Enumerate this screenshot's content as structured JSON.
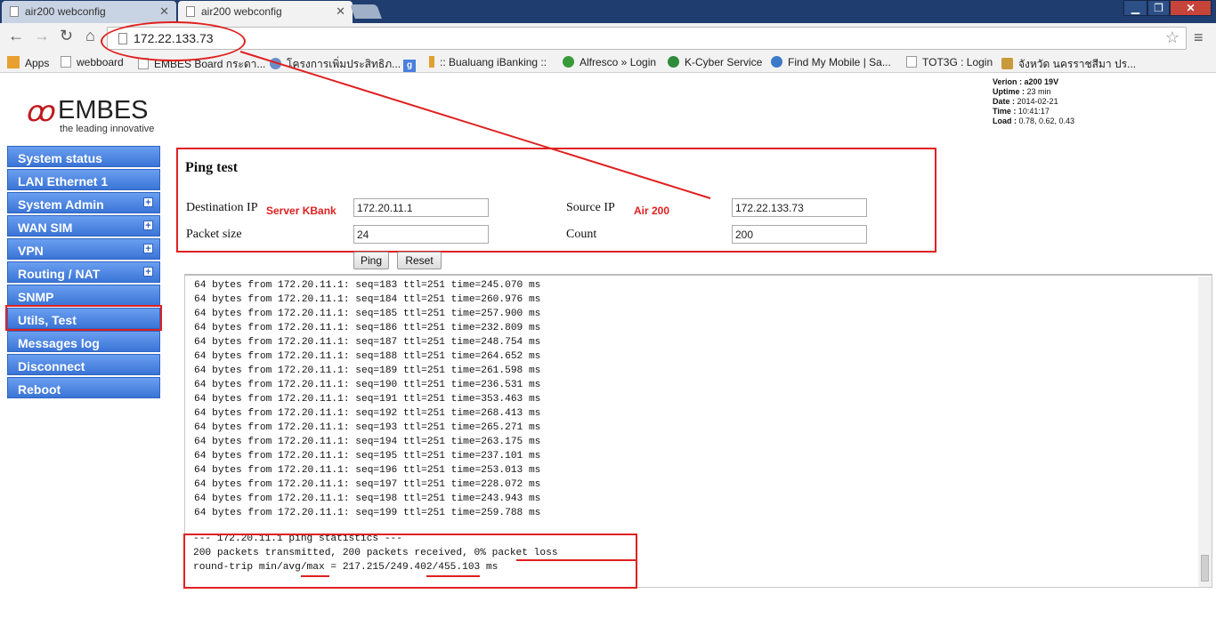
{
  "browser": {
    "tabs": [
      {
        "label": "air200 webconfig"
      },
      {
        "label": "air200 webconfig"
      }
    ],
    "url": "172.22.133.73",
    "bookmarks": [
      "Apps",
      "webboard",
      "EMBES Board กระดา...",
      "โครงการเพิ่มประสิทธิภ...",
      "g",
      ":: Bualuang iBanking ::",
      "Alfresco » Login",
      "K-Cyber Service",
      "Find My Mobile | Sa...",
      "TOT3G : Login",
      "จังหวัด นครราชสีมา ปร..."
    ]
  },
  "logo": {
    "name": "EMBES",
    "tagline": "the leading innovative"
  },
  "sysinfo": {
    "version_label": "Verion :",
    "version": "a200 19V",
    "uptime_label": "Uptime :",
    "uptime": "23 min",
    "date_label": "Date :",
    "date": "2014-02-21",
    "time_label": "Time :",
    "time": "10:41:17",
    "load_label": "Load :",
    "load": "0.78, 0.62, 0.43"
  },
  "sidebar": {
    "items": [
      {
        "label": "System status"
      },
      {
        "label": "LAN Ethernet 1"
      },
      {
        "label": "System Admin",
        "expand": "+"
      },
      {
        "label": "WAN SIM",
        "expand": "+"
      },
      {
        "label": "VPN",
        "expand": "+"
      },
      {
        "label": "Routing / NAT",
        "expand": "+"
      },
      {
        "label": "SNMP"
      },
      {
        "label": "Utils, Test"
      },
      {
        "label": "Messages log"
      },
      {
        "label": "Disconnect"
      },
      {
        "label": "Reboot"
      }
    ]
  },
  "ping": {
    "title": "Ping test",
    "dest_label": "Destination IP",
    "dest_note": "Server KBank",
    "dest_value": "172.20.11.1",
    "src_label": "Source IP",
    "src_note": "Air 200",
    "src_value": "172.22.133.73",
    "size_label": "Packet size",
    "size_value": "24",
    "count_label": "Count",
    "count_value": "200",
    "ping_button": "Ping",
    "reset_button": "Reset"
  },
  "output": {
    "lines": "64 bytes from 172.20.11.1: seq=183 ttl=251 time=245.070 ms\n64 bytes from 172.20.11.1: seq=184 ttl=251 time=260.976 ms\n64 bytes from 172.20.11.1: seq=185 ttl=251 time=257.900 ms\n64 bytes from 172.20.11.1: seq=186 ttl=251 time=232.809 ms\n64 bytes from 172.20.11.1: seq=187 ttl=251 time=248.754 ms\n64 bytes from 172.20.11.1: seq=188 ttl=251 time=264.652 ms\n64 bytes from 172.20.11.1: seq=189 ttl=251 time=261.598 ms\n64 bytes from 172.20.11.1: seq=190 ttl=251 time=236.531 ms\n64 bytes from 172.20.11.1: seq=191 ttl=251 time=353.463 ms\n64 bytes from 172.20.11.1: seq=192 ttl=251 time=268.413 ms\n64 bytes from 172.20.11.1: seq=193 ttl=251 time=265.271 ms\n64 bytes from 172.20.11.1: seq=194 ttl=251 time=263.175 ms\n64 bytes from 172.20.11.1: seq=195 ttl=251 time=237.101 ms\n64 bytes from 172.20.11.1: seq=196 ttl=251 time=253.013 ms\n64 bytes from 172.20.11.1: seq=197 ttl=251 time=228.072 ms\n64 bytes from 172.20.11.1: seq=198 ttl=251 time=243.943 ms\n64 bytes from 172.20.11.1: seq=199 ttl=251 time=259.788 ms",
    "stats": "--- 172.20.11.1 ping statistics ---\n200 packets transmitted, 200 packets received, 0% packet loss\nround-trip min/avg/max = 217.215/249.402/455.103 ms"
  },
  "colors": {
    "annotation": "#e02020",
    "sidebar_button": "#3a74d6"
  }
}
